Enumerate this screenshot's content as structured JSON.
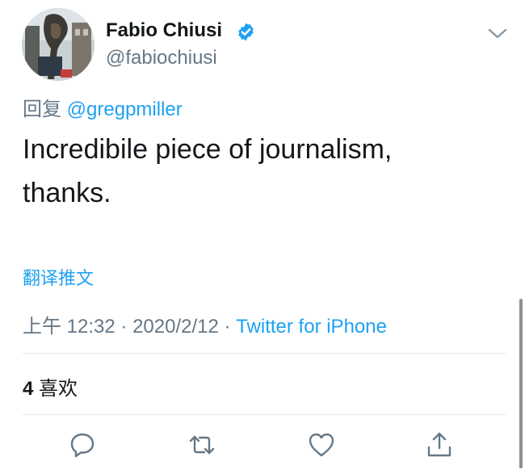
{
  "tweet": {
    "author": {
      "display_name": "Fabio Chiusi",
      "handle": "@fabiochiusi",
      "verified": true
    },
    "reply_prefix": "回复",
    "reply_to": "@gregpmiller",
    "text_line1": "Incredibile piece of journalism,",
    "text_line2": "thanks.",
    "translate_label": "翻译推文",
    "time": "上午 12:32",
    "date": "2020/2/12",
    "source": "Twitter for iPhone",
    "like_count": "4",
    "like_label": "喜欢"
  },
  "colors": {
    "accent": "#1da1f2",
    "secondary_text": "#657786",
    "primary_text": "#14171a",
    "divider": "#e1e8ed"
  },
  "icons": {
    "verified": "verified-badge-icon",
    "menu": "chevron-down-icon",
    "reply": "reply-bubble-icon",
    "retweet": "retweet-icon",
    "like": "heart-icon",
    "share": "share-icon"
  }
}
